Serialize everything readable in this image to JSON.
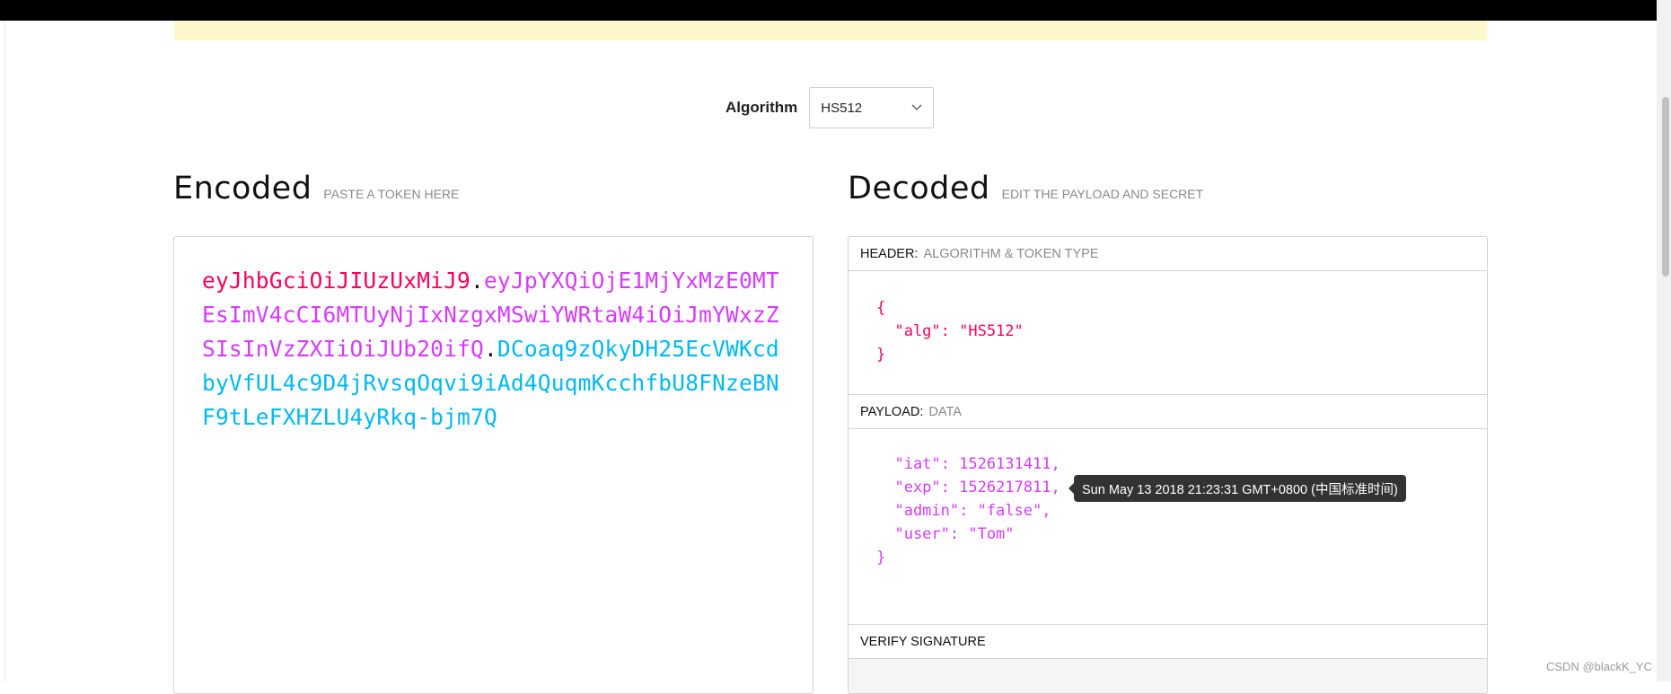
{
  "algorithm": {
    "label": "Algorithm",
    "selected": "HS512"
  },
  "encoded": {
    "title": "Encoded",
    "subtitle": "PASTE A TOKEN HERE",
    "header_part": "eyJhbGciOiJIUzUxMiJ9",
    "payload_part": "eyJpYXQiOjE1MjYxMzE0MTEsImV4cCI6MTUyNjIxNzgxMSwiYWRtaW4iOiJmYWxzZSIsInVzZXIiOiJUb20ifQ",
    "signature_part": "DCoaq9zQkyDH25EcVWKcdbyVfUL4c9D4jRvsqOqvi9iAd4QuqmKcchfbU8FNzeBNF9tLeFXHZLU4yRkq-bjm7Q",
    "dot": "."
  },
  "decoded": {
    "title": "Decoded",
    "subtitle": "EDIT THE PAYLOAD AND SECRET",
    "header_section": {
      "label": "HEADER:",
      "sublabel": "ALGORITHM & TOKEN TYPE"
    },
    "header_json": {
      "open": "{",
      "alg_line": "  \"alg\": \"HS512\"",
      "close": "}"
    },
    "payload_section": {
      "label": "PAYLOAD:",
      "sublabel": "DATA"
    },
    "payload_json": {
      "iat_line": "  \"iat\": 1526131411,",
      "exp_line": "  \"exp\": 1526217811,",
      "admin_line": "  \"admin\": \"false\",",
      "user_line": "  \"user\": \"Tom\"",
      "close": "}"
    },
    "verify_section": {
      "label": "VERIFY SIGNATURE"
    }
  },
  "tooltip": {
    "text": "Sun May 13 2018 21:23:31 GMT+0800 (中国标准时间)"
  },
  "watermark": "CSDN @blackK_YC"
}
